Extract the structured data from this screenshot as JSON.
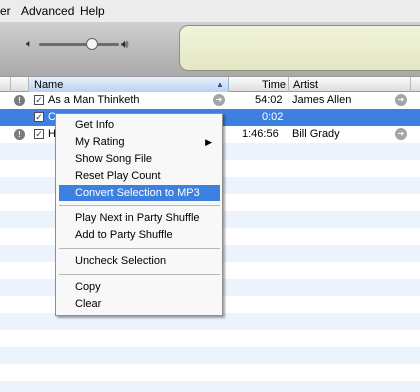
{
  "menubar": {
    "items": [
      "er",
      "Advanced",
      "Help"
    ]
  },
  "toolbar": {
    "volume_level": 0.78
  },
  "columns": {
    "name": "Name",
    "time": "Time",
    "artist": "Artist"
  },
  "rows": [
    {
      "name": "As a Man Thinketh",
      "time": "54:02",
      "artist": "James Allen",
      "checked": true
    },
    {
      "name": "C",
      "time": "0:02",
      "artist": "",
      "checked": true,
      "selected": true
    },
    {
      "name": "H",
      "time": "1:46:56",
      "artist": "Bill Grady",
      "checked": true
    }
  ],
  "context_menu": {
    "items": [
      {
        "label": "Get Info"
      },
      {
        "label": "My Rating",
        "submenu": true
      },
      {
        "label": "Show Song File"
      },
      {
        "label": "Reset Play Count"
      },
      {
        "label": "Convert Selection to MP3",
        "highlighted": true
      },
      {
        "label": "Play Next in Party Shuffle"
      },
      {
        "label": "Add to Party Shuffle"
      },
      {
        "label": "Uncheck Selection"
      },
      {
        "label": "Copy"
      },
      {
        "label": "Clear"
      }
    ]
  },
  "colors": {
    "selection": "#3d80df",
    "lcd": "#e8ebc9",
    "row_alt": "#edf3fd"
  }
}
